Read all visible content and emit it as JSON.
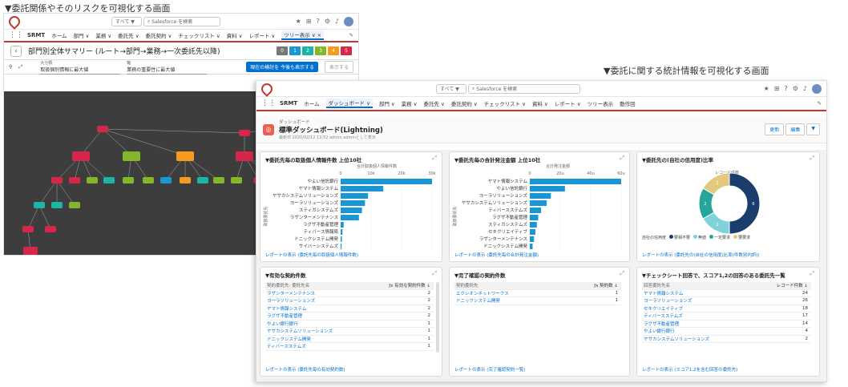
{
  "captions": {
    "left": "▼委託関係やそのリスクを可視化する画面",
    "right": "▼委託に関する統計情報を可視化する画面"
  },
  "colors": {
    "brand": "#c23934",
    "accent": "#0070d2",
    "bar": "#1b96d4"
  },
  "header": {
    "scope": "すべて ▼",
    "search_placeholder": "Salesforce を検索",
    "icons": [
      "star-icon",
      "add-icon",
      "help-icon",
      "settings-icon",
      "bell-icon",
      "avatar"
    ]
  },
  "nav": {
    "app": "SRMT",
    "items": [
      "ホーム",
      "部門 ∨",
      "業務 ∨",
      "委託先 ∨",
      "委託契約 ∨",
      "チェックリスト ∨",
      "資料 ∨",
      "レポート ∨"
    ],
    "tab_left": "ツリー表示 ∨ ×",
    "items_right": [
      "ホーム",
      "ダッシュボード ∨",
      "部門 ∨",
      "業務 ∨",
      "委託先 ∨",
      "委託契約 ∨",
      "チェックリスト ∨",
      "資料 ∨",
      "レポート ∨",
      "ツリー表示",
      "動作回"
    ]
  },
  "left_screen": {
    "page_title": "部門別全体サマリー (ルート→部門→業務→一次委託先以降)",
    "legend": [
      "0",
      "1",
      "2",
      "3",
      "4",
      "5"
    ],
    "filter1_label": "大分類",
    "filter1_value": "取扱個別情報に最大値",
    "filter2_label": "軸",
    "filter2_value": "業務の重要性に最大値",
    "apply_button": "現在の検討を 今後も表示する",
    "display_button": "表示する"
  },
  "dashboard": {
    "sub": "ダッシュボード",
    "title": "標準ダッシュボード(Lightning)",
    "meta": "最新日 2020/02/12 13:52 admin adminとして表示",
    "buttons": [
      "更新",
      "編集",
      "▼"
    ]
  },
  "cards": {
    "c1": {
      "title": "▼委託先毎の取扱個人情報件数 上位10社",
      "axis_title": "合計取扱個人情報件数",
      "ylabel": "取扱委託先",
      "ticks": [
        "0",
        "10k",
        "20k",
        "30k"
      ],
      "link": "レポートの表示 (委託先毎の取扱個人情報件数)"
    },
    "c2": {
      "title": "▼委託先毎の合計発注金額 上位10社",
      "axis_title": "合計発注金額",
      "ylabel": "取扱委託先",
      "ticks": [
        "0",
        "20u",
        "40u",
        "60u"
      ],
      "link": "レポートの表示 (委託先毎の合計発注金額)"
    },
    "c3": {
      "title": "▼委託先の(自社の信用度)比率",
      "center": "レコード件数",
      "legend_label": "自社の信用度",
      "legend": [
        "要相不要",
        "無値",
        "一定要求",
        "要要求"
      ],
      "link": "レポートの表示 (委託先の(自社の信用度)比率(件数別内訳))"
    },
    "c4": {
      "title": "▼有効な契約件数",
      "col1": "契約委託先: 委託先名",
      "col2": "ƒx 有効な契約件数 ↓",
      "rows": [
        [
          "ラザンターメンテナンス",
          "2"
        ],
        [
          "ヨーラソリューションズ",
          "2"
        ],
        [
          "ヤマト情報システム",
          "2"
        ],
        [
          "ラグザ不動産管理",
          "2"
        ],
        [
          "やよい銀行銀行",
          "1"
        ],
        [
          "ヤサカシステムソリューションズ",
          "1"
        ],
        [
          "ドニックシステム開発",
          "1"
        ],
        [
          "ティバースステムズ",
          "1"
        ]
      ],
      "link": "レポートの表示 (委託先毎の有効契約数)"
    },
    "c5": {
      "title": "▼完了確認の契約件数",
      "col1": "契約委託先",
      "col2": "ƒx 契約数 ↓",
      "rows": [
        [
          "エクシオンネットワークス",
          "1"
        ],
        [
          "ドニックシステム開発",
          "1"
        ]
      ],
      "link": "レポートの表示 (完了確認契約一覧)"
    },
    "c6": {
      "title": "▼チェックシート回答で、スコア1,2の回答のある委託先一覧",
      "col1": "回答委託先名",
      "col2": "レコード件数 ↓",
      "rows": [
        [
          "ヤマト情報システム",
          "24"
        ],
        [
          "ヨーラソリューションズ",
          "26"
        ],
        [
          "セキクリエイティブ",
          "18"
        ],
        [
          "ティバースステムズ",
          "17"
        ],
        [
          "ラグザ不動産管理",
          "14"
        ],
        [
          "やよい銀行銀行",
          "4"
        ],
        [
          "ヤサカシステムソリューションズ",
          "2"
        ]
      ],
      "link": "レポートの表示 (スコア1,2を含む回答の委託先)"
    }
  },
  "chart_data": [
    {
      "type": "bar",
      "title": "▼委託先毎の取扱個人情報件数 上位10社",
      "xlabel": "合計取扱個人情報件数",
      "ylabel": "取扱委託先",
      "categories": [
        "やよい信託銀行",
        "ヤマト情報システム",
        "ヤサカシステムソリューションズ",
        "ヨーラソリューションズ",
        "スティガシステムズ",
        "ラザンターメンテナンス",
        "ラグザ不動産管理",
        "ティバース情報局",
        "ドニックシステム開発",
        "サイバーシステムズ"
      ],
      "values": [
        30000,
        14000,
        9000,
        8000,
        7000,
        6000,
        1000,
        600,
        400,
        300
      ],
      "xlim": [
        0,
        30000
      ]
    },
    {
      "type": "bar",
      "title": "▼委託先毎の合計発注金額 上位10社",
      "xlabel": "合計発注金額",
      "ylabel": "取扱委託先",
      "categories": [
        "ヤマト情報システム",
        "やよい信託銀行",
        "ヨーラソリューションズ",
        "ヤサカシステムソリューションズ",
        "ティバースステムズ",
        "ラグザ不動産管理",
        "スティガシステムズ",
        "セキクリエイティブ",
        "ラザンターメンテナンス",
        "ドニックシステム開発"
      ],
      "values": [
        65,
        25,
        15,
        12,
        8,
        6,
        5,
        4,
        3,
        2
      ],
      "xlim": [
        0,
        65
      ]
    },
    {
      "type": "pie",
      "title": "▼委託先の(自社の信用度)比率",
      "categories": [
        "要相不要",
        "無値",
        "一定要求",
        "要要求"
      ],
      "values": [
        6,
        2,
        2,
        2
      ]
    }
  ]
}
